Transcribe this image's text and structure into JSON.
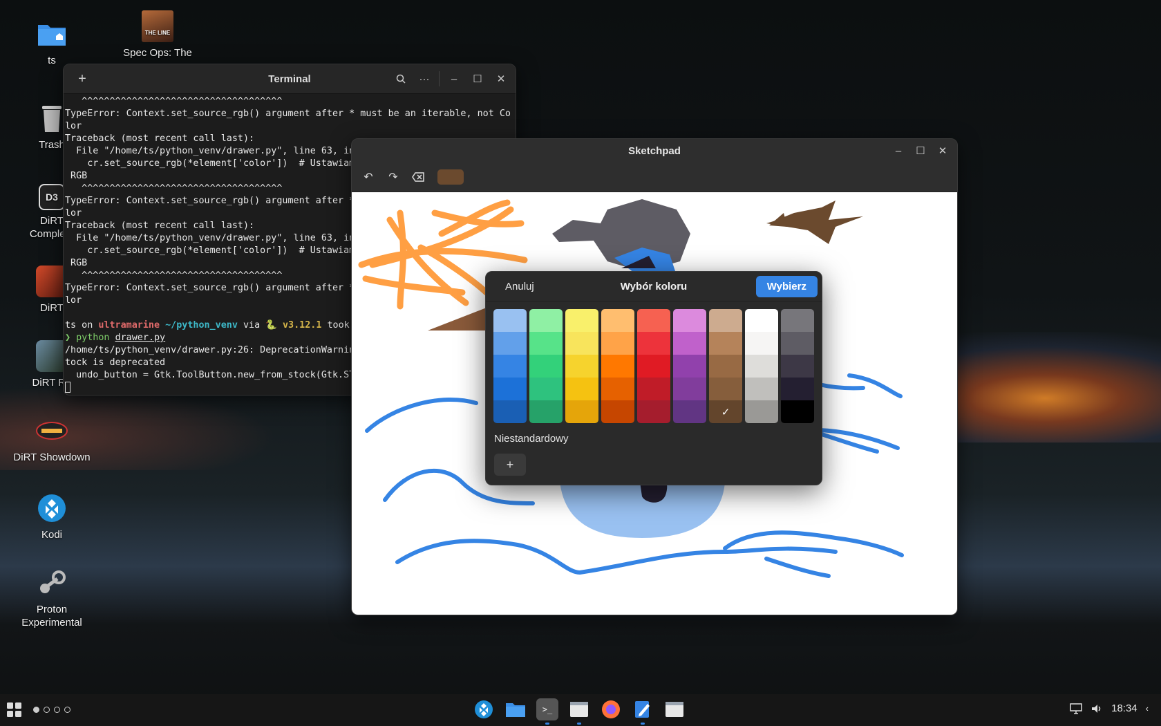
{
  "desktop": {
    "icons": [
      {
        "label": "ts",
        "icon": "home-folder-icon"
      },
      {
        "label": "Spec Ops: The",
        "icon": "spec-ops-game-icon"
      },
      {
        "label": "Trash",
        "icon": "trash-icon"
      },
      {
        "label": "DiRT\nComplete",
        "icon": "dirt3-game-icon"
      },
      {
        "label": "DiRT",
        "icon": "dirt-game-icon"
      },
      {
        "label": "DiRT Ra",
        "icon": "dirt-rally-game-icon"
      },
      {
        "label": "DiRT Showdown",
        "icon": "dirt-showdown-game-icon"
      },
      {
        "label": "Kodi",
        "icon": "kodi-icon"
      },
      {
        "label": "Proton\nExperimental",
        "icon": "steam-proton-icon"
      }
    ],
    "game_cover_text": "THE LINE"
  },
  "terminal": {
    "title": "Terminal",
    "lines": [
      {
        "t": "   ^^^^^^^^^^^^^^^^^^^^^^^^^^^^^^^^^^^^"
      },
      {
        "t": "TypeError: Context.set_source_rgb() argument after * must be an iterable, not Co"
      },
      {
        "t": "lor"
      },
      {
        "t": "Traceback (most recent call last):"
      },
      {
        "t": "  File \"/home/ts/python_venv/drawer.py\", line 63, in"
      },
      {
        "t": "    cr.set_source_rgb(*element['color'])  # Ustawiam"
      },
      {
        "t": " RGB"
      },
      {
        "t": "   ^^^^^^^^^^^^^^^^^^^^^^^^^^^^^^^^^^^^"
      },
      {
        "t": "TypeError: Context.set_source_rgb() argument after *"
      },
      {
        "t": "lor"
      },
      {
        "t": "Traceback (most recent call last):"
      },
      {
        "t": "  File \"/home/ts/python_venv/drawer.py\", line 63, in"
      },
      {
        "t": "    cr.set_source_rgb(*element['color'])  # Ustawiam"
      },
      {
        "t": " RGB"
      },
      {
        "t": "   ^^^^^^^^^^^^^^^^^^^^^^^^^^^^^^^^^^^^"
      },
      {
        "t": "TypeError: Context.set_source_rgb() argument after *"
      },
      {
        "t": "lor"
      },
      {
        "t": ""
      }
    ],
    "prompt": {
      "user": "ts",
      "on": " on ",
      "host": "ultramarine",
      "path": " ~/python_venv",
      "via": " via ",
      "snake": "🐍",
      "version": " v3.12.1",
      "took": " took"
    },
    "command_arrow": "❯",
    "command": " python ",
    "command_arg": "drawer.py",
    "after_lines": [
      "/home/ts/python_venv/drawer.py:26: DeprecationWarnin",
      "tock is deprecated",
      "  undo_button = Gtk.ToolButton.new_from_stock(Gtk.ST"
    ]
  },
  "sketchpad": {
    "title": "Sketchpad",
    "current_color": "#6b4a2e"
  },
  "color_dialog": {
    "cancel_label": "Anuluj",
    "title": "Wybór koloru",
    "confirm_label": "Wybierz",
    "custom_label": "Niestandardowy",
    "add_icon": "+",
    "palette": [
      [
        "#99c1f1",
        "#62a0ea",
        "#3584e4",
        "#1c71d8",
        "#1a5fb4"
      ],
      [
        "#8ff0a4",
        "#57e389",
        "#33d17a",
        "#2ec27e",
        "#26a269"
      ],
      [
        "#f9f06b",
        "#f8e45c",
        "#f6d32d",
        "#f5c211",
        "#e5a50a"
      ],
      [
        "#ffbe6f",
        "#ffa348",
        "#ff7800",
        "#e66100",
        "#c64600"
      ],
      [
        "#f66151",
        "#ed333b",
        "#e01b24",
        "#c01c28",
        "#a51d2d"
      ],
      [
        "#dc8add",
        "#c061cb",
        "#9141ac",
        "#813d9c",
        "#613583"
      ],
      [
        "#cdab8f",
        "#b5835a",
        "#986a44",
        "#865e3c",
        "#63452c"
      ],
      [
        "#ffffff",
        "#f6f5f4",
        "#deddda",
        "#c0bfbc",
        "#9a9996"
      ],
      [
        "#77767b",
        "#5e5c64",
        "#3d3846",
        "#241f31",
        "#000000"
      ]
    ],
    "selected": [
      6,
      4
    ]
  },
  "taskbar": {
    "time": "18:34",
    "apps": [
      "kodi-icon",
      "files-icon",
      "terminal-icon",
      "window-icon",
      "firefox-icon",
      "text-editor-icon",
      "window-icon-2"
    ]
  }
}
